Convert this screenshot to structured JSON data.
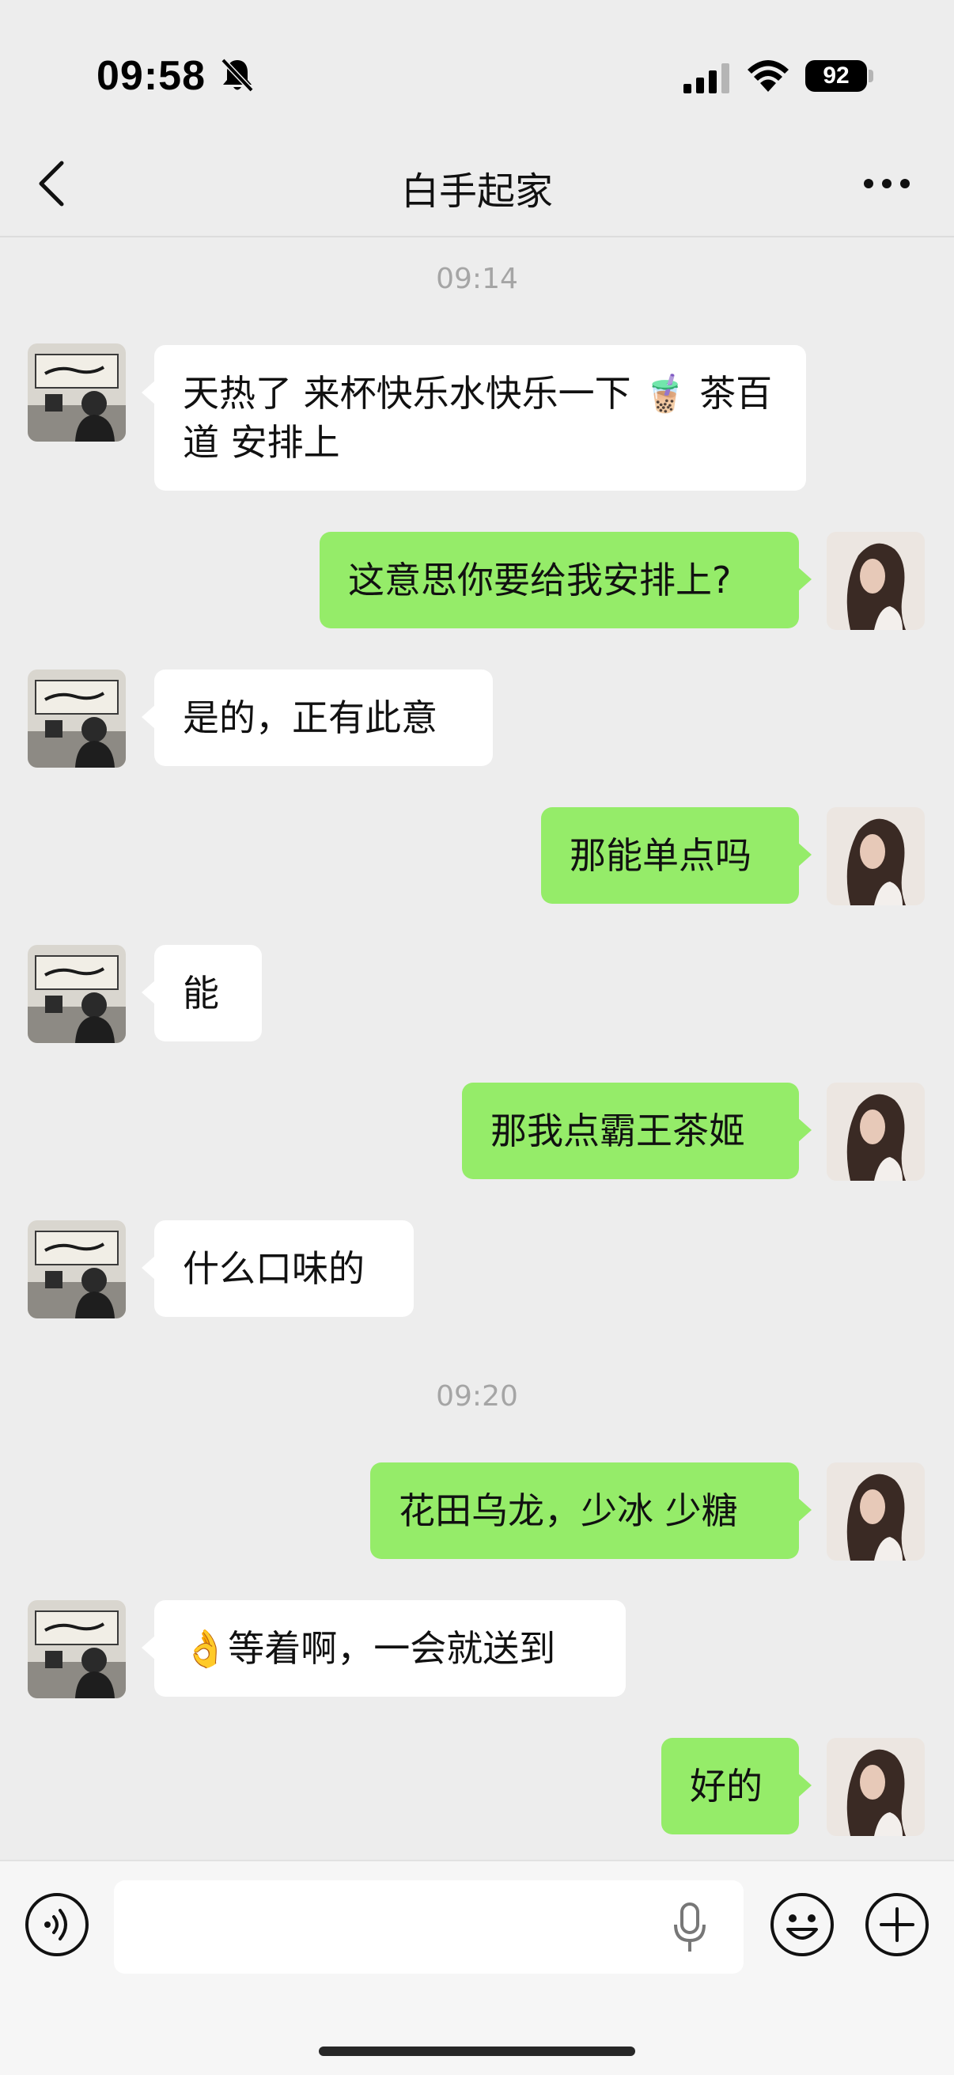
{
  "status_bar": {
    "time": "09:58",
    "battery": "92"
  },
  "nav": {
    "title": "白手起家"
  },
  "timestamps": [
    "09:14",
    "09:20"
  ],
  "messages": [
    {
      "side": "left",
      "text": "天热了 来杯快乐水快乐一下 🧋 茶百道 安排上"
    },
    {
      "side": "right",
      "text": "这意思你要给我安排上?"
    },
    {
      "side": "left",
      "text": "是的，正有此意"
    },
    {
      "side": "right",
      "text": "那能单点吗"
    },
    {
      "side": "left",
      "text": "能"
    },
    {
      "side": "right",
      "text": "那我点霸王茶姬"
    },
    {
      "side": "left",
      "text": "什么口味的"
    },
    {
      "side": "right",
      "text": "花田乌龙，少冰 少糖"
    },
    {
      "side": "left",
      "text": "👌等着啊，一会就送到"
    },
    {
      "side": "right",
      "text": "好的"
    }
  ],
  "icons": {
    "back": "chevron-left-icon",
    "more": "more-dots-icon",
    "voice": "voice-icon",
    "mic": "mic-icon",
    "emoji": "emoji-icon",
    "plus": "plus-icon"
  },
  "colors": {
    "background": "#ededed",
    "sent_bubble": "#95ec69",
    "received_bubble": "#ffffff",
    "timestamp_text": "#a5a5a5"
  }
}
